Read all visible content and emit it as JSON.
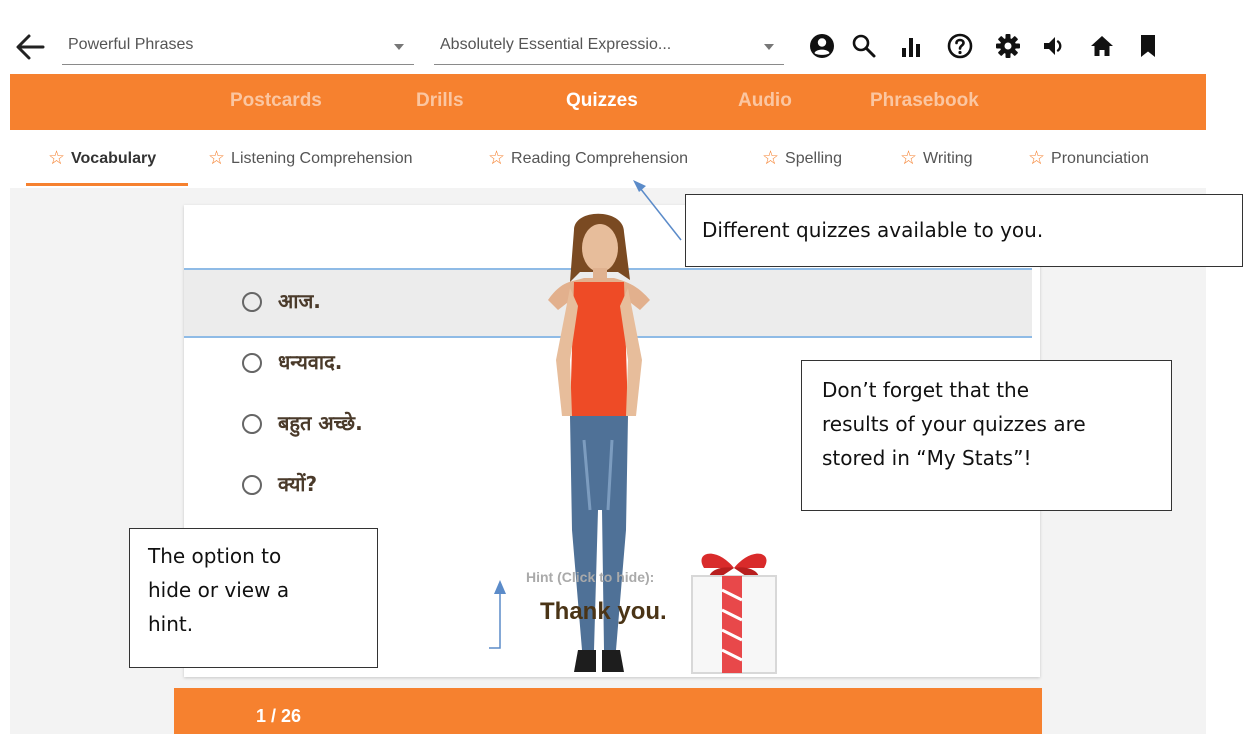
{
  "header": {
    "selector_1": {
      "value": "Powerful Phrases"
    },
    "selector_2": {
      "value": "Absolutely Essential Expressio..."
    },
    "icons": [
      "account-icon",
      "search-icon",
      "stats-icon",
      "help-icon",
      "settings-icon",
      "volume-icon",
      "home-icon",
      "bookmark-icon"
    ]
  },
  "nav": {
    "tabs": [
      {
        "label": "Postcards",
        "active": false
      },
      {
        "label": "Drills",
        "active": false
      },
      {
        "label": "Quizzes",
        "active": true
      },
      {
        "label": "Audio",
        "active": false
      },
      {
        "label": "Phrasebook",
        "active": false
      }
    ]
  },
  "quiz_types": [
    {
      "label": "Vocabulary",
      "active": true
    },
    {
      "label": "Listening Comprehension",
      "active": false
    },
    {
      "label": "Reading Comprehension",
      "active": false
    },
    {
      "label": "Spelling",
      "active": false
    },
    {
      "label": "Writing",
      "active": false
    },
    {
      "label": "Pronunciation",
      "active": false
    }
  ],
  "quiz": {
    "options": [
      "आज.",
      "धन्यवाद.",
      "बहुत अच्छे.",
      "क्यों?"
    ],
    "hint_label": "Hint (Click to hide):",
    "hint_text": "Thank you.",
    "progress": "1 / 26"
  },
  "callouts": {
    "quizzes": "Different quizzes available to you.",
    "stats_line1": "Don’t forget that the",
    "stats_line2": "results of your quizzes are",
    "stats_line3": "stored in “My Stats”!",
    "hint_line1": "The option to",
    "hint_line2": "hide or view a",
    "hint_line3": "hint."
  },
  "colors": {
    "accent": "#f6812f",
    "selection_border": "#8fbbe6",
    "arrow": "#5b8bc9"
  }
}
